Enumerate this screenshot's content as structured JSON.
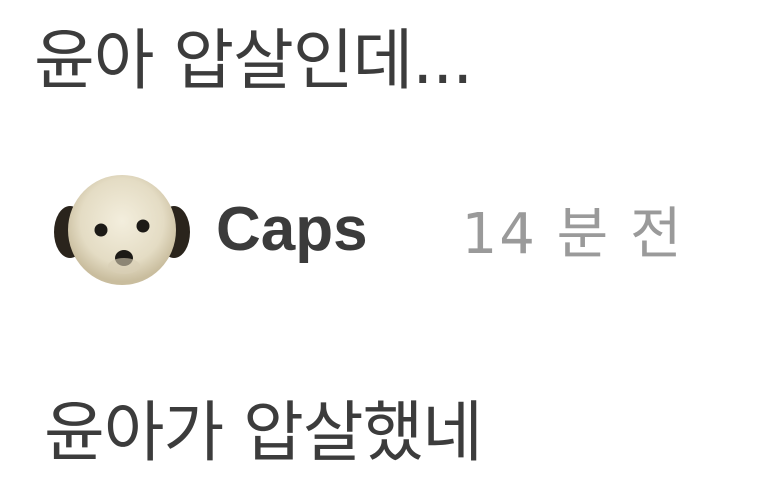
{
  "post": {
    "text": "윤아 압살인데..."
  },
  "comment": {
    "avatar_icon": "dog-face-icon",
    "author": "Caps",
    "time": "14 분 전",
    "text": "윤아가 압살했네"
  }
}
